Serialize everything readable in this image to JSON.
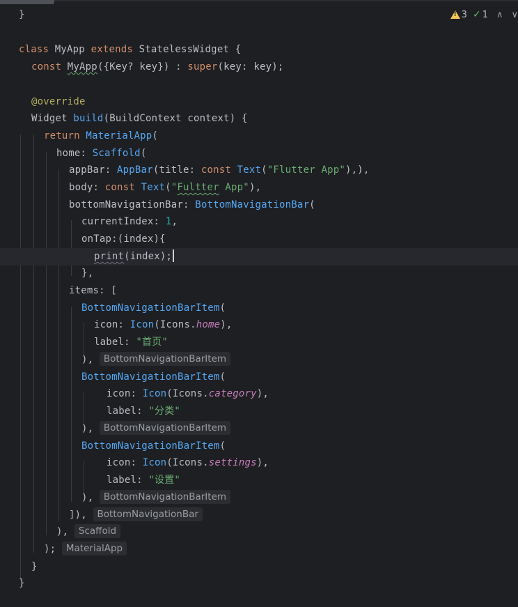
{
  "status": {
    "warnings": "3",
    "weak_warnings": "1",
    "warn_icon": "warning-triangle-icon",
    "check_icon": "weak-warning-check-icon",
    "up_icon": "chevron-up-icon",
    "down_icon": "chevron-down-icon"
  },
  "code": {
    "l1_brace": "}",
    "l3_class": "class",
    "l3_name": "MyApp",
    "l3_extends": "extends",
    "l3_super": "StatelessWidget",
    "l3_tail": "{",
    "l4_const": "const",
    "l4_name": "MyApp",
    "l4_params": "({Key? key}) : ",
    "l4_super": "super",
    "l4_tail": "(key: key);",
    "l6_ann": "@override",
    "l7_type": "Widget",
    "l7_fn": "build",
    "l7_tail": "(BuildContext context) {",
    "l8_return": "return",
    "l8_cls": "MaterialApp",
    "l8_tail": "(",
    "l9_key": "home: ",
    "l9_cls": "Scaffold",
    "l9_tail": "(",
    "l10_key": "appBar: ",
    "l10_cls": "AppBar",
    "l10_mid": "(title: ",
    "l10_const": "const",
    "l10_sp": " ",
    "l10_text": "Text",
    "l10_open": "(",
    "l10_str": "\"Flutter App\"",
    "l10_tail": "),),",
    "l11_key": "body: ",
    "l11_const": "const",
    "l11_text": "Text",
    "l11_open": "(",
    "l11_str_a": "\"",
    "l11_str_b": "Fultter",
    "l11_str_c": " App\"",
    "l11_tail": "),",
    "l12_key": "bottomNavigationBar: ",
    "l12_cls": "BottomNavigationBar",
    "l12_tail": "(",
    "l13_key": "currentIndex: ",
    "l13_num": "1",
    "l13_tail": ",",
    "l14_text": "onTap:(index){",
    "l15_fn": "print",
    "l15_tail": "(index);",
    "l16_text": "},",
    "l17_text": "items: [",
    "l18_cls": "BottomNavigationBarItem",
    "l18_tail": "(",
    "l19_key": "icon: ",
    "l19_cls": "Icon",
    "l19_mid": "(Icons.",
    "l19_val": "home",
    "l19_tail": "),",
    "l20_key": "label: ",
    "l20_str": "\"首页\"",
    "l21_text": "), ",
    "l21_hint": "BottomNavigationBarItem",
    "l22_cls": "BottomNavigationBarItem",
    "l22_tail": "(",
    "l23_key": "icon: ",
    "l23_cls": "Icon",
    "l23_mid": "(Icons.",
    "l23_val": "category",
    "l23_tail": "),",
    "l24_key": "label: ",
    "l24_str": "\"分类\"",
    "l25_text": "), ",
    "l25_hint": "BottomNavigationBarItem",
    "l26_cls": "BottomNavigationBarItem",
    "l26_tail": "(",
    "l27_key": "icon: ",
    "l27_cls": "Icon",
    "l27_mid": "(Icons.",
    "l27_val": "settings",
    "l27_tail": "),",
    "l28_key": "label: ",
    "l28_str": "\"设置\"",
    "l29_text": "), ",
    "l29_hint": "BottomNavigationBarItem",
    "l30_text": "]), ",
    "l30_hint": "BottomNavigationBar",
    "l31_text": "), ",
    "l31_hint": "Scaffold",
    "l32_text": "); ",
    "l32_hint": "MaterialApp",
    "l33_text": "}",
    "l34_text": "}"
  },
  "colors": {
    "background": "#1e1f22",
    "keyword": "#cf8e6d",
    "function": "#56a8f5",
    "string": "#6aab73",
    "number": "#2aacb8",
    "annotation": "#b3ae60",
    "enum_value": "#c77dbb",
    "warning": "#f2c55c",
    "weak_warning": "#5fb865"
  }
}
